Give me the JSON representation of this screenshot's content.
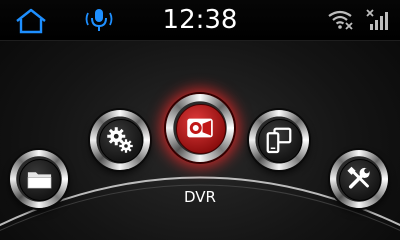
{
  "status_bar": {
    "time": "12:38",
    "icons": [
      "home-icon",
      "microphone-icon",
      "wifi-off-icon",
      "signal-no-service-icon"
    ],
    "accent_color": "#1e90ff"
  },
  "launcher": {
    "apps": [
      {
        "id": "files",
        "icon": "folder-icon"
      },
      {
        "id": "settings",
        "icon": "gears-icon"
      },
      {
        "id": "dvr",
        "icon": "video-camera-icon",
        "label": "DVR",
        "selected": true
      },
      {
        "id": "phone-link",
        "icon": "phone-mirror-icon"
      },
      {
        "id": "tools",
        "icon": "wrench-screwdriver-icon"
      }
    ],
    "selected_label": "DVR",
    "highlight_color": "#e02020"
  }
}
